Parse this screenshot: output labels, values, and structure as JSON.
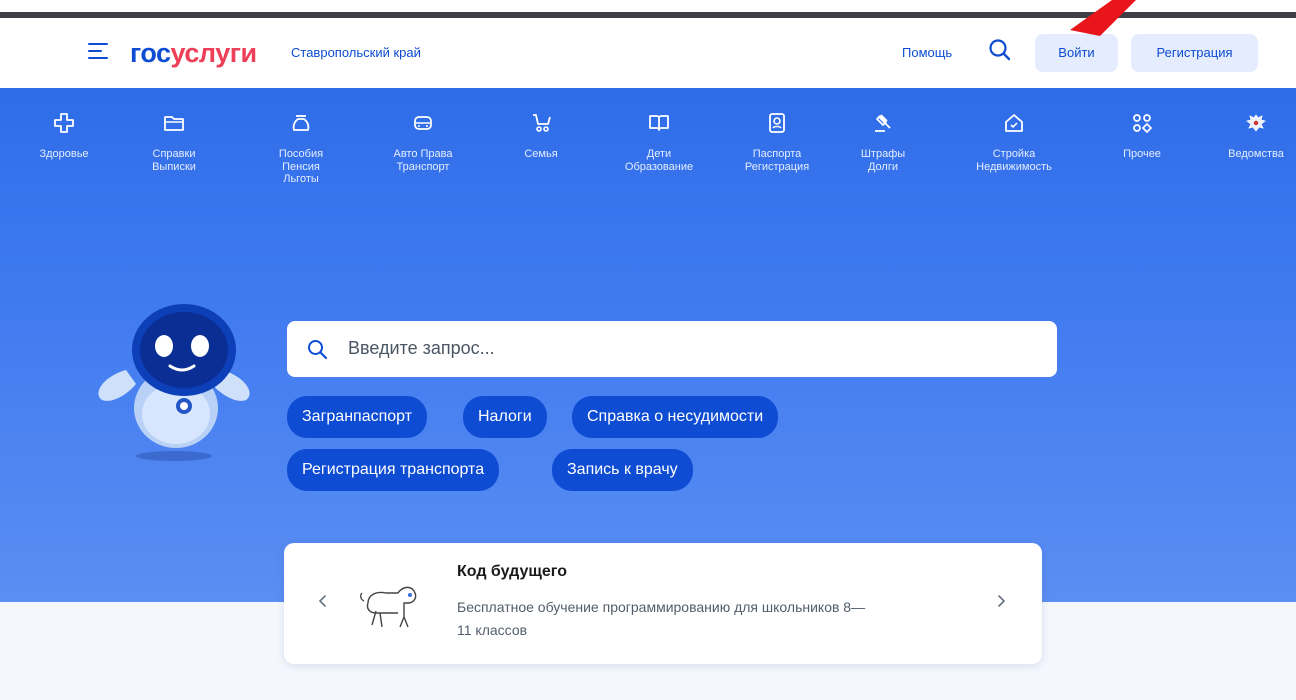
{
  "header": {
    "logo_part1": "гос",
    "logo_part2": "услуги",
    "region": "Ставропольский край",
    "help": "Помощь",
    "login": "Войти",
    "register": "Регистрация"
  },
  "categories": [
    {
      "icon": "health-cross-icon",
      "line1": "Здоровье",
      "line2": "",
      "line3": ""
    },
    {
      "icon": "folder-icon",
      "line1": "Справки",
      "line2": "Выписки",
      "line3": ""
    },
    {
      "icon": "money-bag-icon",
      "line1": "Пособия",
      "line2": "Пенсия",
      "line3": "Льготы"
    },
    {
      "icon": "car-icon",
      "line1": "Авто Права",
      "line2": "Транспорт",
      "line3": ""
    },
    {
      "icon": "stroller-icon",
      "line1": "Семья",
      "line2": "",
      "line3": ""
    },
    {
      "icon": "book-icon",
      "line1": "Дети",
      "line2": "Образование",
      "line3": ""
    },
    {
      "icon": "passport-icon",
      "line1": "Паспорта",
      "line2": "Регистрация",
      "line3": ""
    },
    {
      "icon": "gavel-icon",
      "line1": "Штрафы",
      "line2": "Долги",
      "line3": ""
    },
    {
      "icon": "house-icon",
      "line1": "Стройка",
      "line2": "Недвижимость",
      "line3": ""
    },
    {
      "icon": "grid-icon",
      "line1": "Прочее",
      "line2": "",
      "line3": ""
    },
    {
      "icon": "eagle-emblem-icon",
      "line1": "Ведомства",
      "line2": "",
      "line3": ""
    }
  ],
  "search": {
    "placeholder": "Введите запрос..."
  },
  "chips": [
    "Загранпаспорт",
    "Налоги",
    "Справка о несудимости",
    "Регистрация транспорта",
    "Запись к врачу"
  ],
  "promo": {
    "title": "Код будущего",
    "desc_line1": "Бесплатное обучение программированию для школьников 8—",
    "desc_line2": "11 классов"
  },
  "colors": {
    "brand_blue": "#0d4cd3",
    "brand_red": "#ee3f58",
    "hero_blue": "#3f7af0",
    "annotation_red": "#e8151b"
  }
}
